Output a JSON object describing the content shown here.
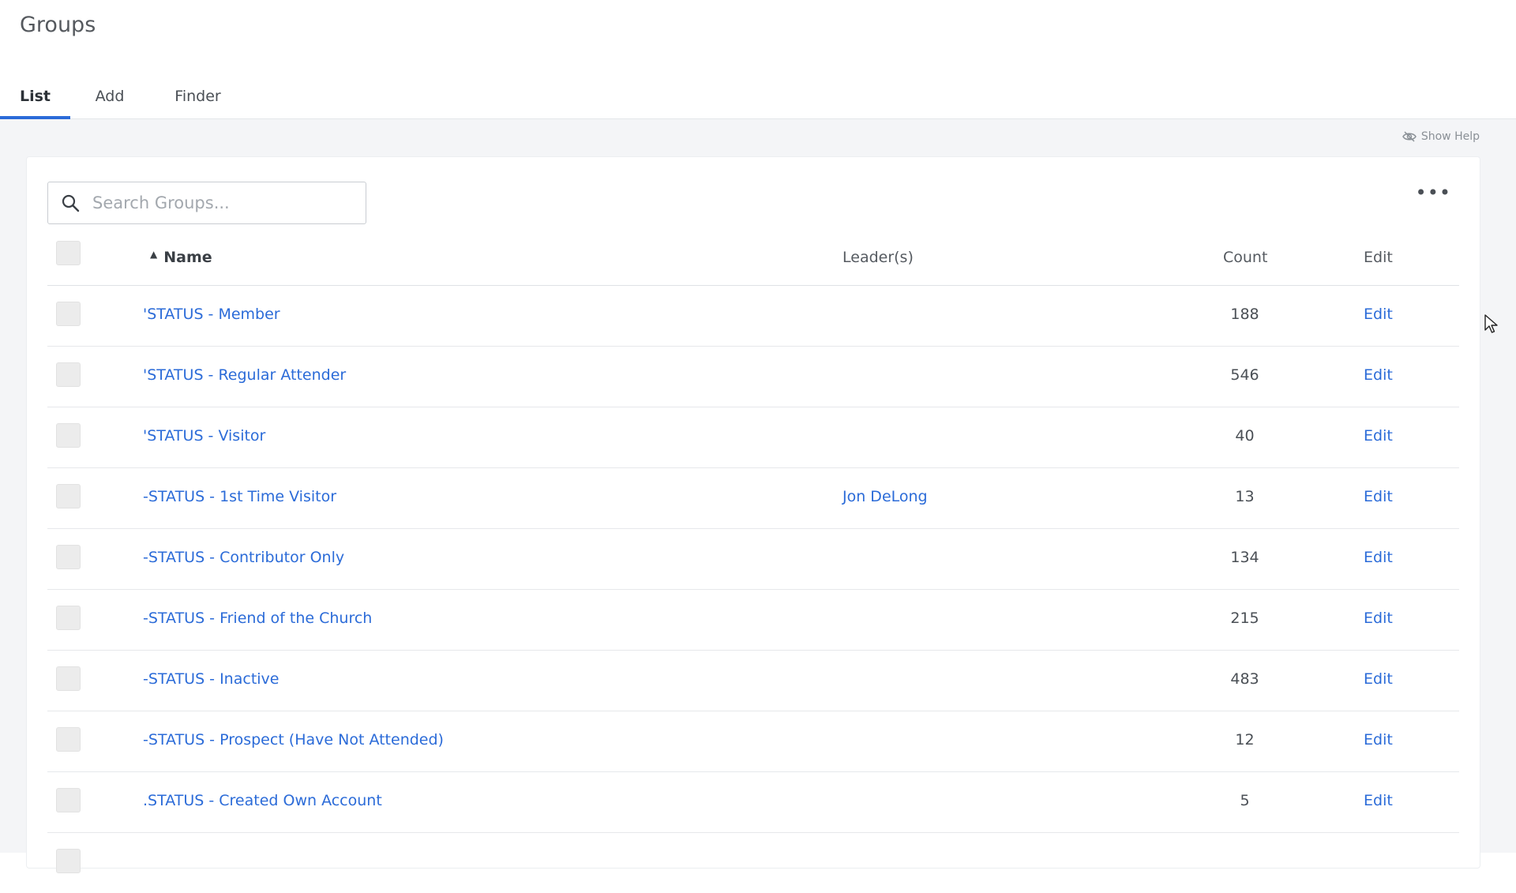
{
  "page": {
    "title": "Groups",
    "tabs": [
      {
        "label": "List"
      },
      {
        "label": "Add"
      },
      {
        "label": "Finder"
      }
    ],
    "show_help_label": "Show Help"
  },
  "search": {
    "placeholder": "Search Groups...",
    "value": ""
  },
  "more_label": "•••",
  "table": {
    "headers": {
      "name": "Name",
      "leaders": "Leader(s)",
      "count": "Count",
      "edit": "Edit"
    },
    "rows": [
      {
        "name": "'STATUS - Member",
        "leader": "",
        "count": "188",
        "edit": "Edit"
      },
      {
        "name": "'STATUS - Regular Attender",
        "leader": "",
        "count": "546",
        "edit": "Edit"
      },
      {
        "name": "'STATUS - Visitor",
        "leader": "",
        "count": "40",
        "edit": "Edit"
      },
      {
        "name": "-STATUS - 1st Time Visitor",
        "leader": "Jon DeLong",
        "count": "13",
        "edit": "Edit"
      },
      {
        "name": "-STATUS - Contributor Only",
        "leader": "",
        "count": "134",
        "edit": "Edit"
      },
      {
        "name": "-STATUS - Friend of the Church",
        "leader": "",
        "count": "215",
        "edit": "Edit"
      },
      {
        "name": "-STATUS - Inactive",
        "leader": "",
        "count": "483",
        "edit": "Edit"
      },
      {
        "name": "-STATUS - Prospect (Have Not Attended)",
        "leader": "",
        "count": "12",
        "edit": "Edit"
      },
      {
        "name": ".STATUS - Created Own Account",
        "leader": "",
        "count": "5",
        "edit": "Edit"
      }
    ]
  },
  "colors": {
    "accent": "#2b6bd8",
    "background": "#f4f5f7"
  }
}
